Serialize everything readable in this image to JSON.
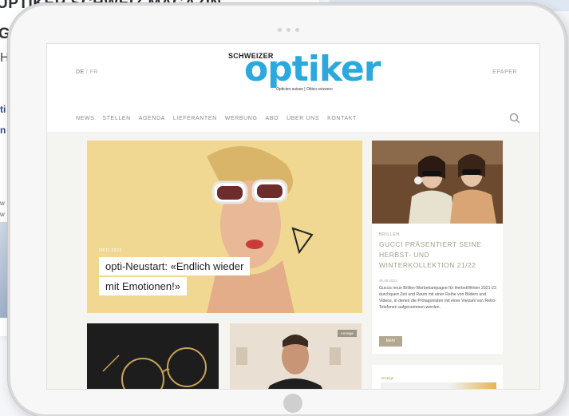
{
  "background": {
    "headline": "UPTIKER SCHWEIZ MAGAZIN",
    "line2": "G",
    "line3": "H",
    "link1": "ti",
    "link2": "n",
    "small1": "w",
    "small2": "w"
  },
  "site": {
    "lang_de": "DE",
    "lang_sep": "/",
    "lang_fr": "FR",
    "epaper": "EPAPER",
    "logo_small": "SCHWEIZER",
    "logo_big": "optiker",
    "logo_tagline": "Opticien suisse | Ottico svizzero",
    "nav": [
      "NEWS",
      "STELLEN",
      "AGENDA",
      "LIEFERANTEN",
      "WERBUNG",
      "ABO",
      "ÜBER UNS",
      "KONTAKT"
    ]
  },
  "hero": {
    "kicker": "OPTI 2022",
    "title_line1": "opti-Neustart: «Endlich wieder",
    "title_line2": "mit Emotionen!»"
  },
  "card": {
    "kicker": "BRILLEN",
    "title": "GUCCI PRÄSENTIERT SEINE HERBST- UND WINTERKOLLEKTION 21/22",
    "date": "08.09.2021",
    "body": "Guccis neue Brillen-Werbekampagne für Herbst/Winter 2021-22 durchquert Zeit und Raum mit einer Reihe von Bildern und Videos, in denen die Protagonisten mit einer Vielzahl von Retro-Telefonen aufgenommen werden.",
    "button": "Mehr"
  },
  "ad": {
    "badge": "Anzeige"
  },
  "tile_right": {
    "label": "Anzeige"
  },
  "colors": {
    "logo_blue": "#2ba8dd",
    "accent_khaki": "#b3a990",
    "nav_gray": "#8a8a8a"
  }
}
